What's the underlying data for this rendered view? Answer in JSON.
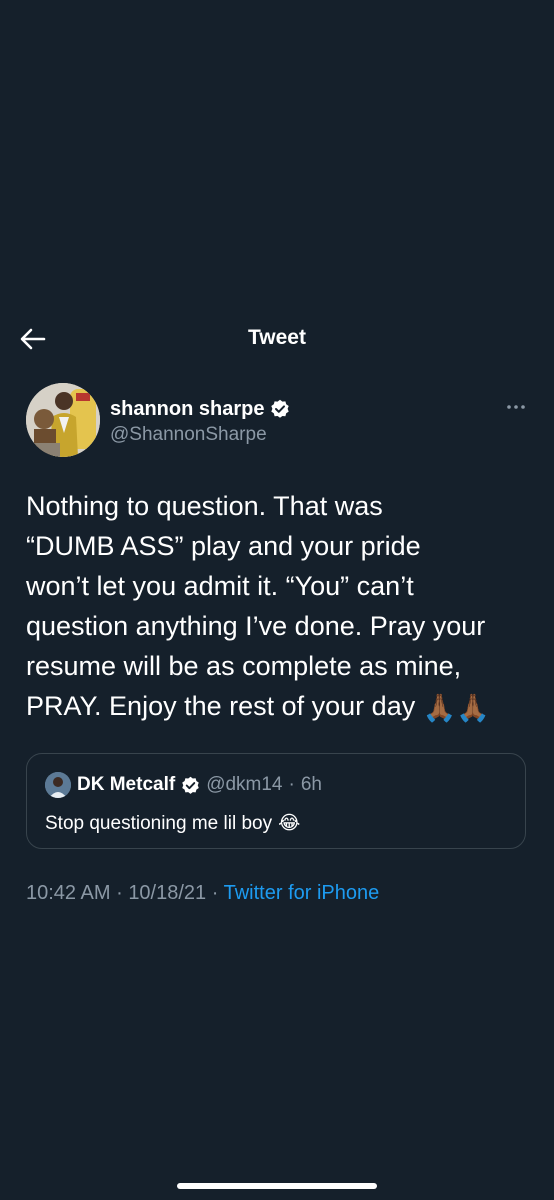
{
  "header": {
    "title": "Tweet",
    "back_icon": "arrow-left-icon"
  },
  "author": {
    "display_name": "shannon sharpe",
    "handle": "@ShannonSharpe",
    "verified": true,
    "more_icon": "more-horizontal-icon"
  },
  "tweet": {
    "text": "Nothing to question. That was\n“DUMB ASS” play and your pride\nwon’t  let you admit it. “You” can’t\nquestion anything I’ve done. Pray your\nresume will be as complete as mine,\nPRAY. Enjoy the rest of your day",
    "trailing_emoji": "🙏🏾🙏🏾"
  },
  "quoted_tweet": {
    "display_name": "DK Metcalf",
    "handle": "@dkm14",
    "separator": "·",
    "time_ago": "6h",
    "text": "Stop questioning me lil boy",
    "trailing_emoji": "😂"
  },
  "meta": {
    "time": "10:42 AM",
    "separator1": "·",
    "date": "10/18/21",
    "separator2": "·",
    "source": "Twitter for iPhone"
  },
  "colors": {
    "background": "#15202b",
    "secondary_text": "#8b98a5",
    "link": "#1d9bf0",
    "verified_badge": "#ffffff",
    "border": "#38444d"
  }
}
